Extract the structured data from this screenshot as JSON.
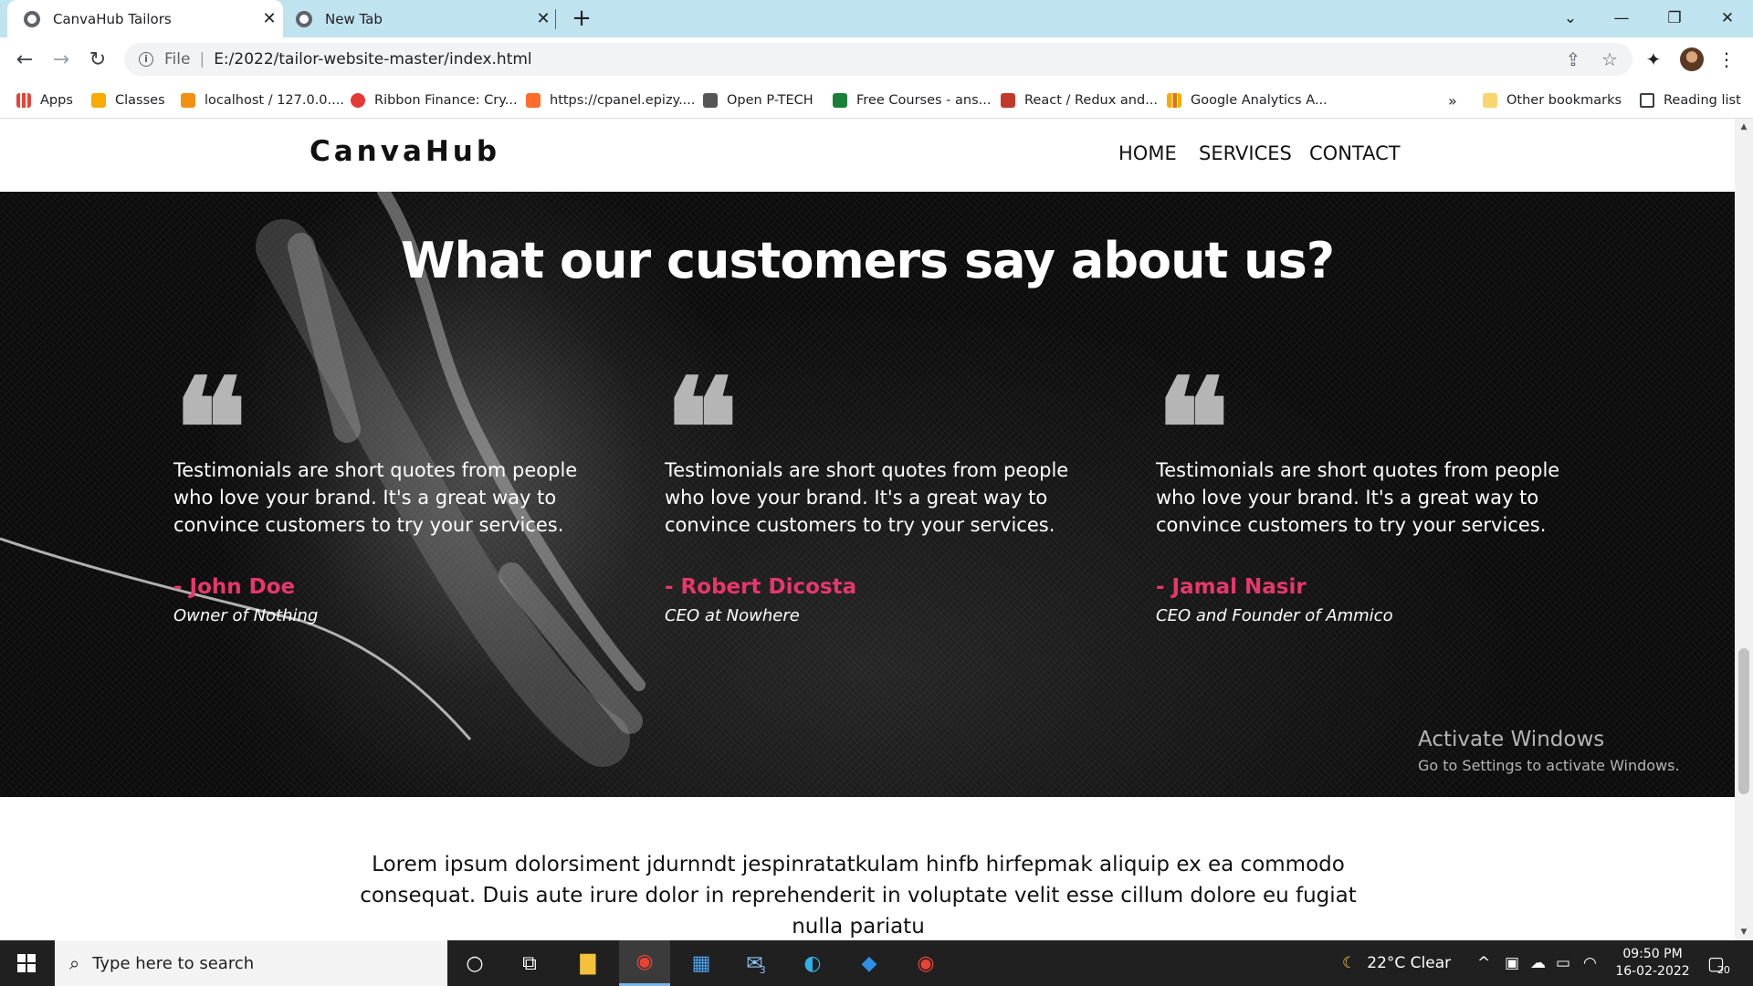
{
  "browser": {
    "tabs": [
      {
        "title": "CanvaHub Tailors",
        "active": true
      },
      {
        "title": "New Tab",
        "active": false
      }
    ],
    "new_tab_symbol": "+",
    "window_controls": {
      "menu": "⌄",
      "minimize": "—",
      "restore": "❐",
      "close": "✕"
    },
    "address": {
      "scheme": "File",
      "divider": "|",
      "url": "E:/2022/tailor-website-master/index.html"
    },
    "bookmarks": [
      {
        "label": "Apps",
        "icon": "apps-grid-icon",
        "color": "#4285f4"
      },
      {
        "label": "Classes",
        "icon": "classes-icon",
        "color": "#f9ab00"
      },
      {
        "label": "localhost / 127.0.0....",
        "icon": "phpmyadmin-icon",
        "color": "#f29111"
      },
      {
        "label": "Ribbon Finance: Cry...",
        "icon": "ribbon-icon",
        "color": "#e53935"
      },
      {
        "label": "https://cpanel.epizy....",
        "icon": "cpanel-icon",
        "color": "#ff6c2c"
      },
      {
        "label": "Open P-TECH",
        "icon": "ptech-icon",
        "color": "#555555"
      },
      {
        "label": "Free Courses - ans...",
        "icon": "courses-icon",
        "color": "#1a7f37"
      },
      {
        "label": "React / Redux and...",
        "icon": "udemy-icon",
        "color": "#c0392b"
      },
      {
        "label": "Google Analytics A...",
        "icon": "analytics-icon",
        "color": "#f9ab00"
      }
    ],
    "bookmarks_overflow": "»",
    "other_bookmarks": "Other bookmarks",
    "reading_list": "Reading list"
  },
  "site": {
    "logo": "CanvaHub",
    "nav": [
      "HOME",
      "SERVICES",
      "CONTACT"
    ],
    "testimonials": {
      "title": "What our customers say about us?",
      "items": [
        {
          "quote": "Testimonials are short quotes from people who love your brand. It's a great way to convince customers to try your services.",
          "author": "- John Doe",
          "role": "Owner of Nothing"
        },
        {
          "quote": "Testimonials are short quotes from people who love your brand. It's a great way to convince customers to try your services.",
          "author": "- Robert Dicosta",
          "role": "CEO at Nowhere"
        },
        {
          "quote": "Testimonials are short quotes from people who love your brand. It's a great way to convince customers to try your services.",
          "author": "- Jamal Nasir",
          "role": "CEO and Founder of Ammico"
        }
      ],
      "quote_symbol": "❝",
      "accent_color": "#e8376b"
    },
    "lorem": "Lorem ipsum dolorsiment jdurnndt jespinratatkulam hinfb hirfepmak aliquip ex ea commodo consequat. Duis aute irure dolor in reprehenderit in voluptate velit esse cillum dolore eu fugiat nulla pariatu"
  },
  "watermark": {
    "line1": "Activate Windows",
    "line2": "Go to Settings to activate Windows."
  },
  "taskbar": {
    "search_placeholder": "Type here to search",
    "mail_badge": "3",
    "weather": "22°C  Clear",
    "time": "09:50 PM",
    "date": "16-02-2022",
    "notification_count": "20"
  }
}
